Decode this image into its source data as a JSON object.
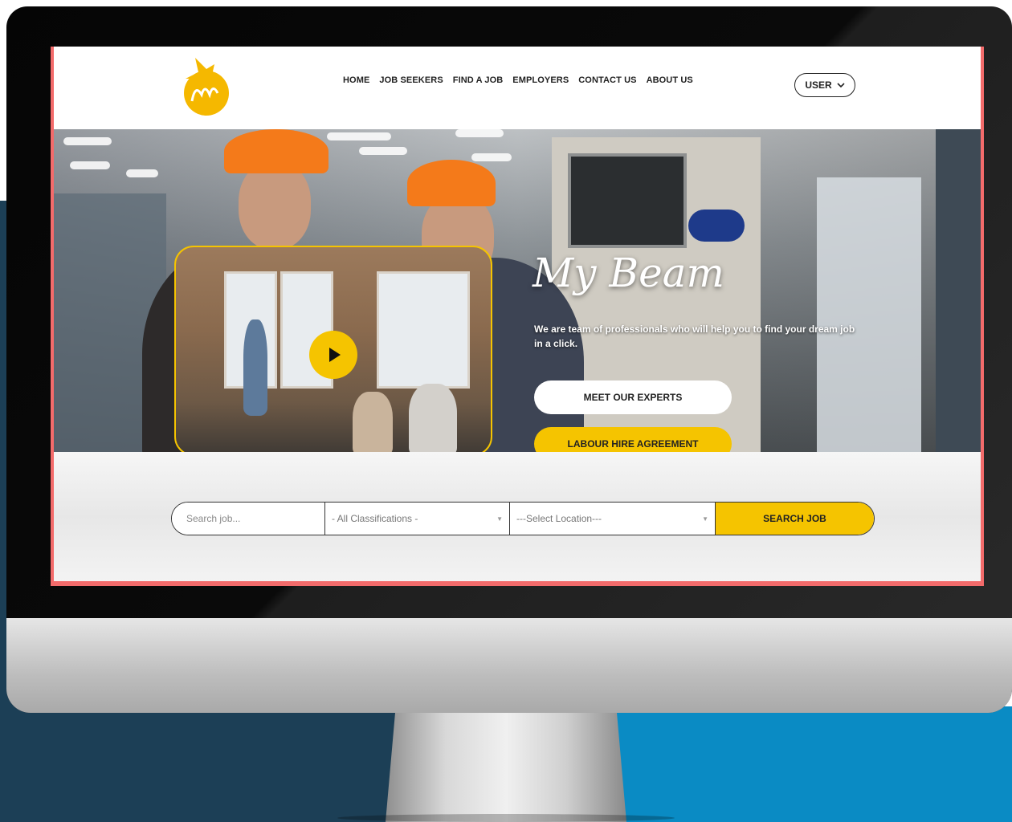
{
  "nav": {
    "items": [
      "HOME",
      "JOB SEEKERS",
      "FIND A JOB",
      "EMPLOYERS",
      "CONTACT US",
      "ABOUT US"
    ],
    "user_label": "USER"
  },
  "hero": {
    "brand": "My Beam",
    "tagline": "We are team of professionals who will help you to find your dream job in a click.",
    "cta_primary": "MEET OUR EXPERTS",
    "cta_secondary": "LABOUR HIRE AGREEMENT"
  },
  "search": {
    "placeholder": "Search job...",
    "classification": "- All Classifications -",
    "location": "---Select Location---",
    "button": "SEARCH JOB"
  },
  "colors": {
    "accent": "#f5c400",
    "frame_border": "#f36b6b",
    "backdrop_dark": "#1c3f56",
    "backdrop_blue": "#0a8bc4"
  },
  "icons": [
    "mybeam-logo-icon",
    "chevron-down-icon",
    "play-icon",
    "caret-down-icon"
  ]
}
